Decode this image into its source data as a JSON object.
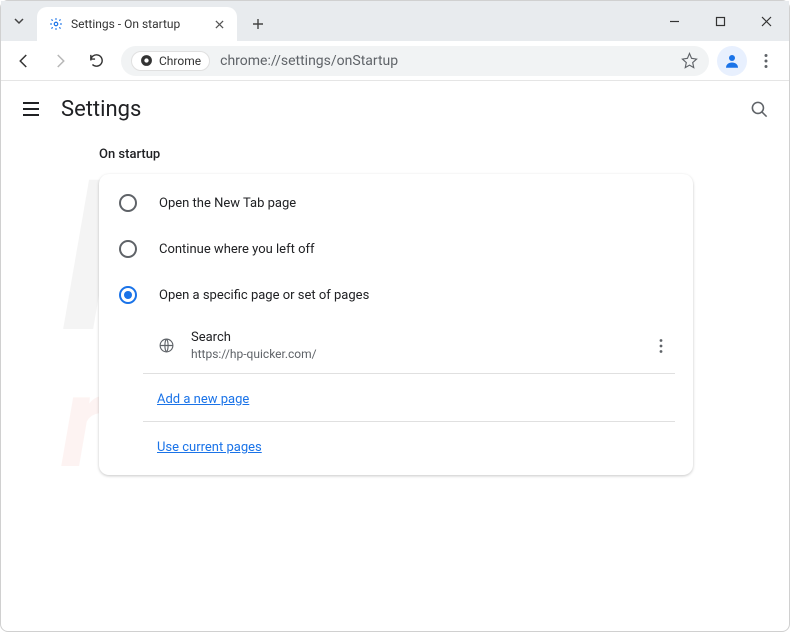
{
  "titlebar": {
    "tab_title": "Settings - On startup"
  },
  "toolbar": {
    "chip_label": "Chrome",
    "url": "chrome://settings/onStartup"
  },
  "header": {
    "title": "Settings"
  },
  "section": {
    "title": "On startup",
    "options": [
      {
        "label": "Open the New Tab page",
        "selected": false
      },
      {
        "label": "Continue where you left off",
        "selected": false
      },
      {
        "label": "Open a specific page or set of pages",
        "selected": true
      }
    ],
    "pages": [
      {
        "name": "Search",
        "url": "https://hp-quicker.com/"
      }
    ],
    "add_link": "Add a new page",
    "use_link": "Use current pages"
  }
}
